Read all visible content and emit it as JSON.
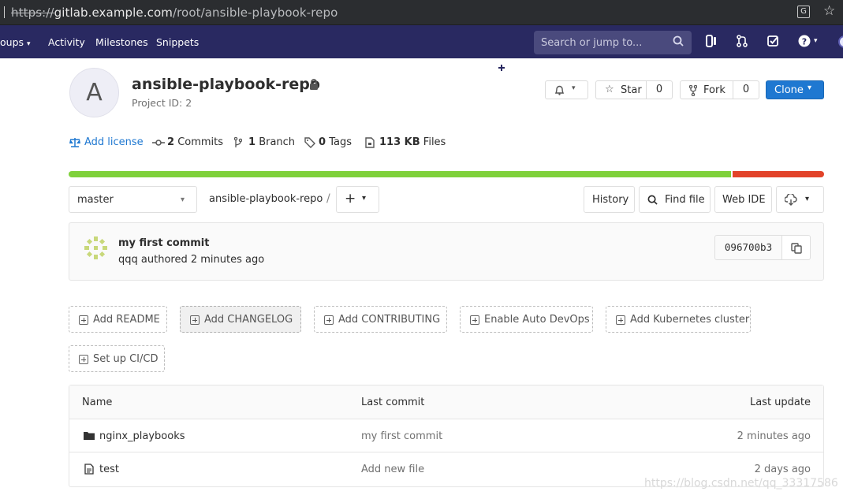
{
  "browser": {
    "url_scheme": "https://",
    "url_host": "gitlab.example.com",
    "url_path": "/root/ansible-playbook-repo"
  },
  "navbar": {
    "groups_label": "oups",
    "activity_label": "Activity",
    "milestones_label": "Milestones",
    "snippets_label": "Snippets",
    "search_placeholder": "Search or jump to..."
  },
  "project": {
    "avatar_letter": "A",
    "name": "ansible-playbook-repo",
    "id_text": "Project ID: 2",
    "star_label": "Star",
    "star_count": "0",
    "fork_label": "Fork",
    "fork_count": "0",
    "clone_label": "Clone"
  },
  "stats": {
    "add_license": "Add license",
    "commits_num": "2",
    "commits_label": "Commits",
    "branch_num": "1",
    "branch_label": "Branch",
    "tags_num": "0",
    "tags_label": "Tags",
    "size_num": "113 KB",
    "size_label": "Files"
  },
  "language_bar": {
    "colors": [
      "#7fd13b",
      "#e24329"
    ]
  },
  "repo_toolbar": {
    "branch": "master",
    "path": "ansible-playbook-repo",
    "separator": "/",
    "history": "History",
    "find_file": "Find file",
    "web_ide": "Web IDE"
  },
  "last_commit": {
    "title": "my first commit",
    "author": "qqq",
    "authored": "authored",
    "time": "2 minutes ago",
    "sha": "096700b3"
  },
  "add_buttons": [
    "Add README",
    "Add CHANGELOG",
    "Add CONTRIBUTING",
    "Enable Auto DevOps",
    "Add Kubernetes cluster",
    "Set up CI/CD"
  ],
  "files": {
    "columns": [
      "Name",
      "Last commit",
      "Last update"
    ],
    "rows": [
      {
        "name": "nginx_playbooks",
        "type": "folder",
        "commit": "my first commit",
        "updated": "2 minutes ago"
      },
      {
        "name": "test",
        "type": "file",
        "commit": "Add new file",
        "updated": "2 days ago"
      }
    ]
  },
  "watermark": "https://blog.csdn.net/qq_33317586",
  "colors": {
    "navbar": "#292961",
    "primary": "#1f78d1",
    "link": "#1f78d1"
  }
}
